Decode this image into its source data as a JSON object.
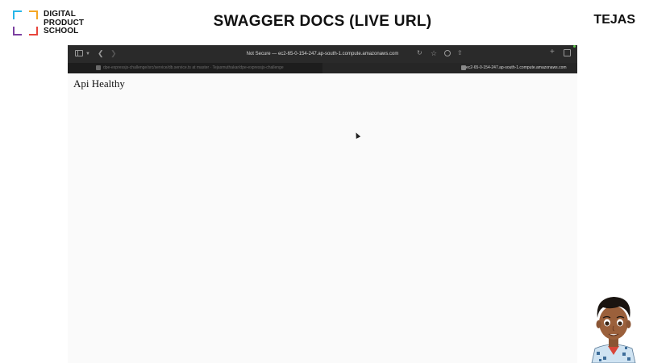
{
  "slide": {
    "logo_lines": [
      "DIGITAL",
      "PRODUCT",
      "SCHOOL"
    ],
    "title": "SWAGGER DOCS (LIVE URL)",
    "presenter": "TEJAS"
  },
  "browser": {
    "url_bar": "Not Secure — ec2-65-0-154-247.ap-south-1.compute.amazonaws.com",
    "tabs": [
      {
        "label": "dpe-expressjs-challenge/src/service/db.service.ts at master · Tejasmuthakar/dpe-expressjs-challenge",
        "active": false
      },
      {
        "label": "ec2-65-0-154-247.ap-south-1.compute.amazonaws.com",
        "active": true
      }
    ],
    "page_text": "Api Healthy"
  },
  "colors": {
    "toolbar": "#2a2a2a",
    "page_bg": "#fafafa"
  }
}
